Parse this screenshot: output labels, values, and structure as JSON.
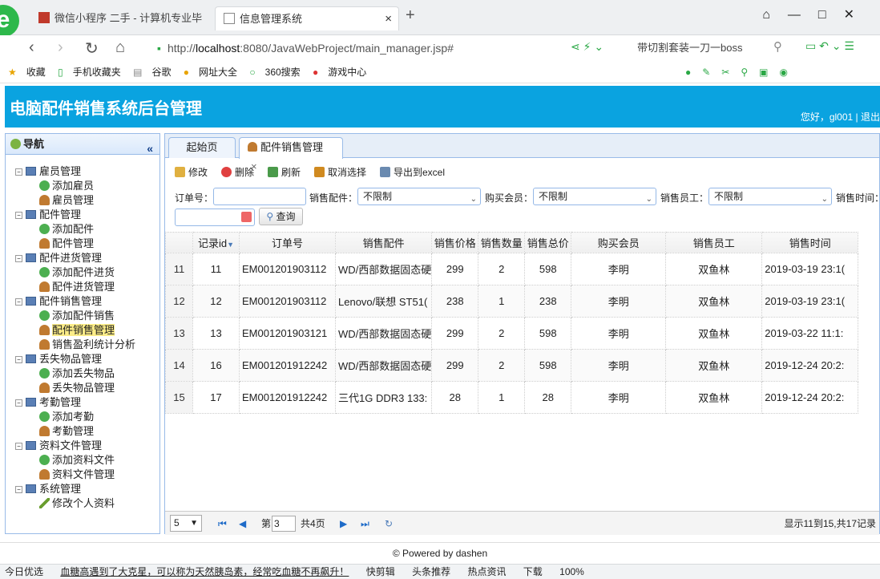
{
  "browser": {
    "tabs": [
      {
        "label": "微信小程序 二手 - 计算机专业毕"
      },
      {
        "label": "信息管理系统"
      }
    ],
    "url_prefix": "http://",
    "url_host": "localhost",
    "url_rest": ":8080/JavaWebProject/main_manager.jsp#",
    "hot_search": "带切割套装一刀一boss",
    "bookmarks": [
      "收藏",
      "手机收藏夹",
      "谷歌",
      "网址大全",
      "360搜索",
      "游戏中心"
    ]
  },
  "app": {
    "title": "电脑配件销售系统后台管理",
    "welcome": "您好，gl001 | 退出"
  },
  "sidebar": {
    "title": "导航",
    "collapse": "«",
    "groups": [
      {
        "label": "雇员管理",
        "items": [
          "添加雇员",
          "雇员管理"
        ]
      },
      {
        "label": "配件管理",
        "items": [
          "添加配件",
          "配件管理"
        ]
      },
      {
        "label": "配件进货管理",
        "items": [
          "添加配件进货",
          "配件进货管理"
        ]
      },
      {
        "label": "配件销售管理",
        "items": [
          "添加配件销售",
          "配件销售管理",
          "销售盈利统计分析"
        ]
      },
      {
        "label": "丢失物品管理",
        "items": [
          "添加丢失物品",
          "丢失物品管理"
        ]
      },
      {
        "label": "考勤管理",
        "items": [
          "添加考勤",
          "考勤管理"
        ]
      },
      {
        "label": "资料文件管理",
        "items": [
          "添加资料文件",
          "资料文件管理"
        ]
      },
      {
        "label": "系统管理",
        "items": [
          "修改个人资料"
        ]
      }
    ]
  },
  "main": {
    "tabs": [
      "起始页",
      "配件销售管理"
    ],
    "tab_close": "×",
    "toolbar": {
      "edit": "修改",
      "delete": "删除",
      "refresh": "刷新",
      "cancel": "取消选择",
      "export": "导出到excel"
    },
    "filters": {
      "order_label": "订单号：",
      "part_label": "销售配件：",
      "part_value": "不限制",
      "member_label": "购买会员：",
      "member_value": "不限制",
      "staff_label": "销售员工：",
      "staff_value": "不限制",
      "time_label": "销售时间：",
      "query": "查询"
    },
    "grid": {
      "columns": [
        "记录id",
        "订单号",
        "销售配件",
        "销售价格",
        "销售数量",
        "销售总价",
        "购买会员",
        "销售员工",
        "销售时间"
      ],
      "sort_indicator": "▼",
      "rows": [
        {
          "rn": "11",
          "id": "11",
          "order": "EM001201903112",
          "part": "WD/西部数据固态硬",
          "price": "299",
          "qty": "2",
          "total": "598",
          "member": "李明",
          "staff": "双鱼林",
          "time": "2019-03-19 23:1("
        },
        {
          "rn": "12",
          "id": "12",
          "order": "EM001201903112",
          "part": "Lenovo/联想 ST51(",
          "price": "238",
          "qty": "1",
          "total": "238",
          "member": "李明",
          "staff": "双鱼林",
          "time": "2019-03-19 23:1("
        },
        {
          "rn": "13",
          "id": "13",
          "order": "EM001201903121",
          "part": "WD/西部数据固态硬",
          "price": "299",
          "qty": "2",
          "total": "598",
          "member": "李明",
          "staff": "双鱼林",
          "time": "2019-03-22 11:1:"
        },
        {
          "rn": "14",
          "id": "16",
          "order": "EM001201912242",
          "part": "WD/西部数据固态硬",
          "price": "299",
          "qty": "2",
          "total": "598",
          "member": "李明",
          "staff": "双鱼林",
          "time": "2019-12-24 20:2:"
        },
        {
          "rn": "15",
          "id": "17",
          "order": "EM001201912242",
          "part": "三代1G DDR3 133:",
          "price": "28",
          "qty": "1",
          "total": "28",
          "member": "李明",
          "staff": "双鱼林",
          "time": "2019-12-24 20:2:"
        }
      ]
    },
    "pager": {
      "page_size": "5",
      "page_prefix": "第",
      "page_value": "3",
      "page_total": "共4页",
      "summary": "显示11到15,共17记录"
    }
  },
  "footer": "© Powered by dashen",
  "statusbar": [
    "今日优选",
    "血糖高遇到了大克星，可以称为天然胰岛素，经常吃血糖不再飙升！",
    "快剪辑",
    "头条推荐",
    "热点资讯",
    "下载",
    "100%"
  ]
}
